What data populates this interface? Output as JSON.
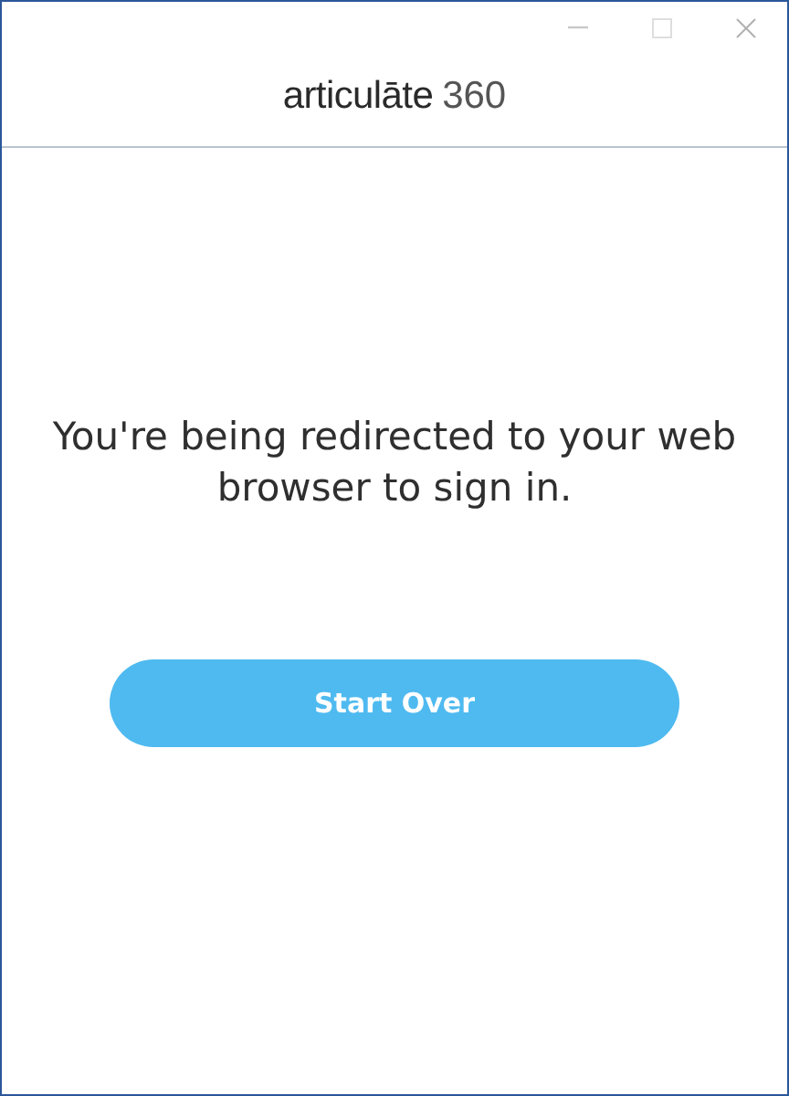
{
  "window": {
    "controls": [
      {
        "kind": "minimize"
      },
      {
        "kind": "maximize"
      },
      {
        "kind": "close"
      }
    ]
  },
  "header": {
    "logo_word": "articulāte",
    "logo_number": "360"
  },
  "message": "You're being redirected to your web browser to sign in.",
  "button": {
    "label": "Start Over"
  }
}
